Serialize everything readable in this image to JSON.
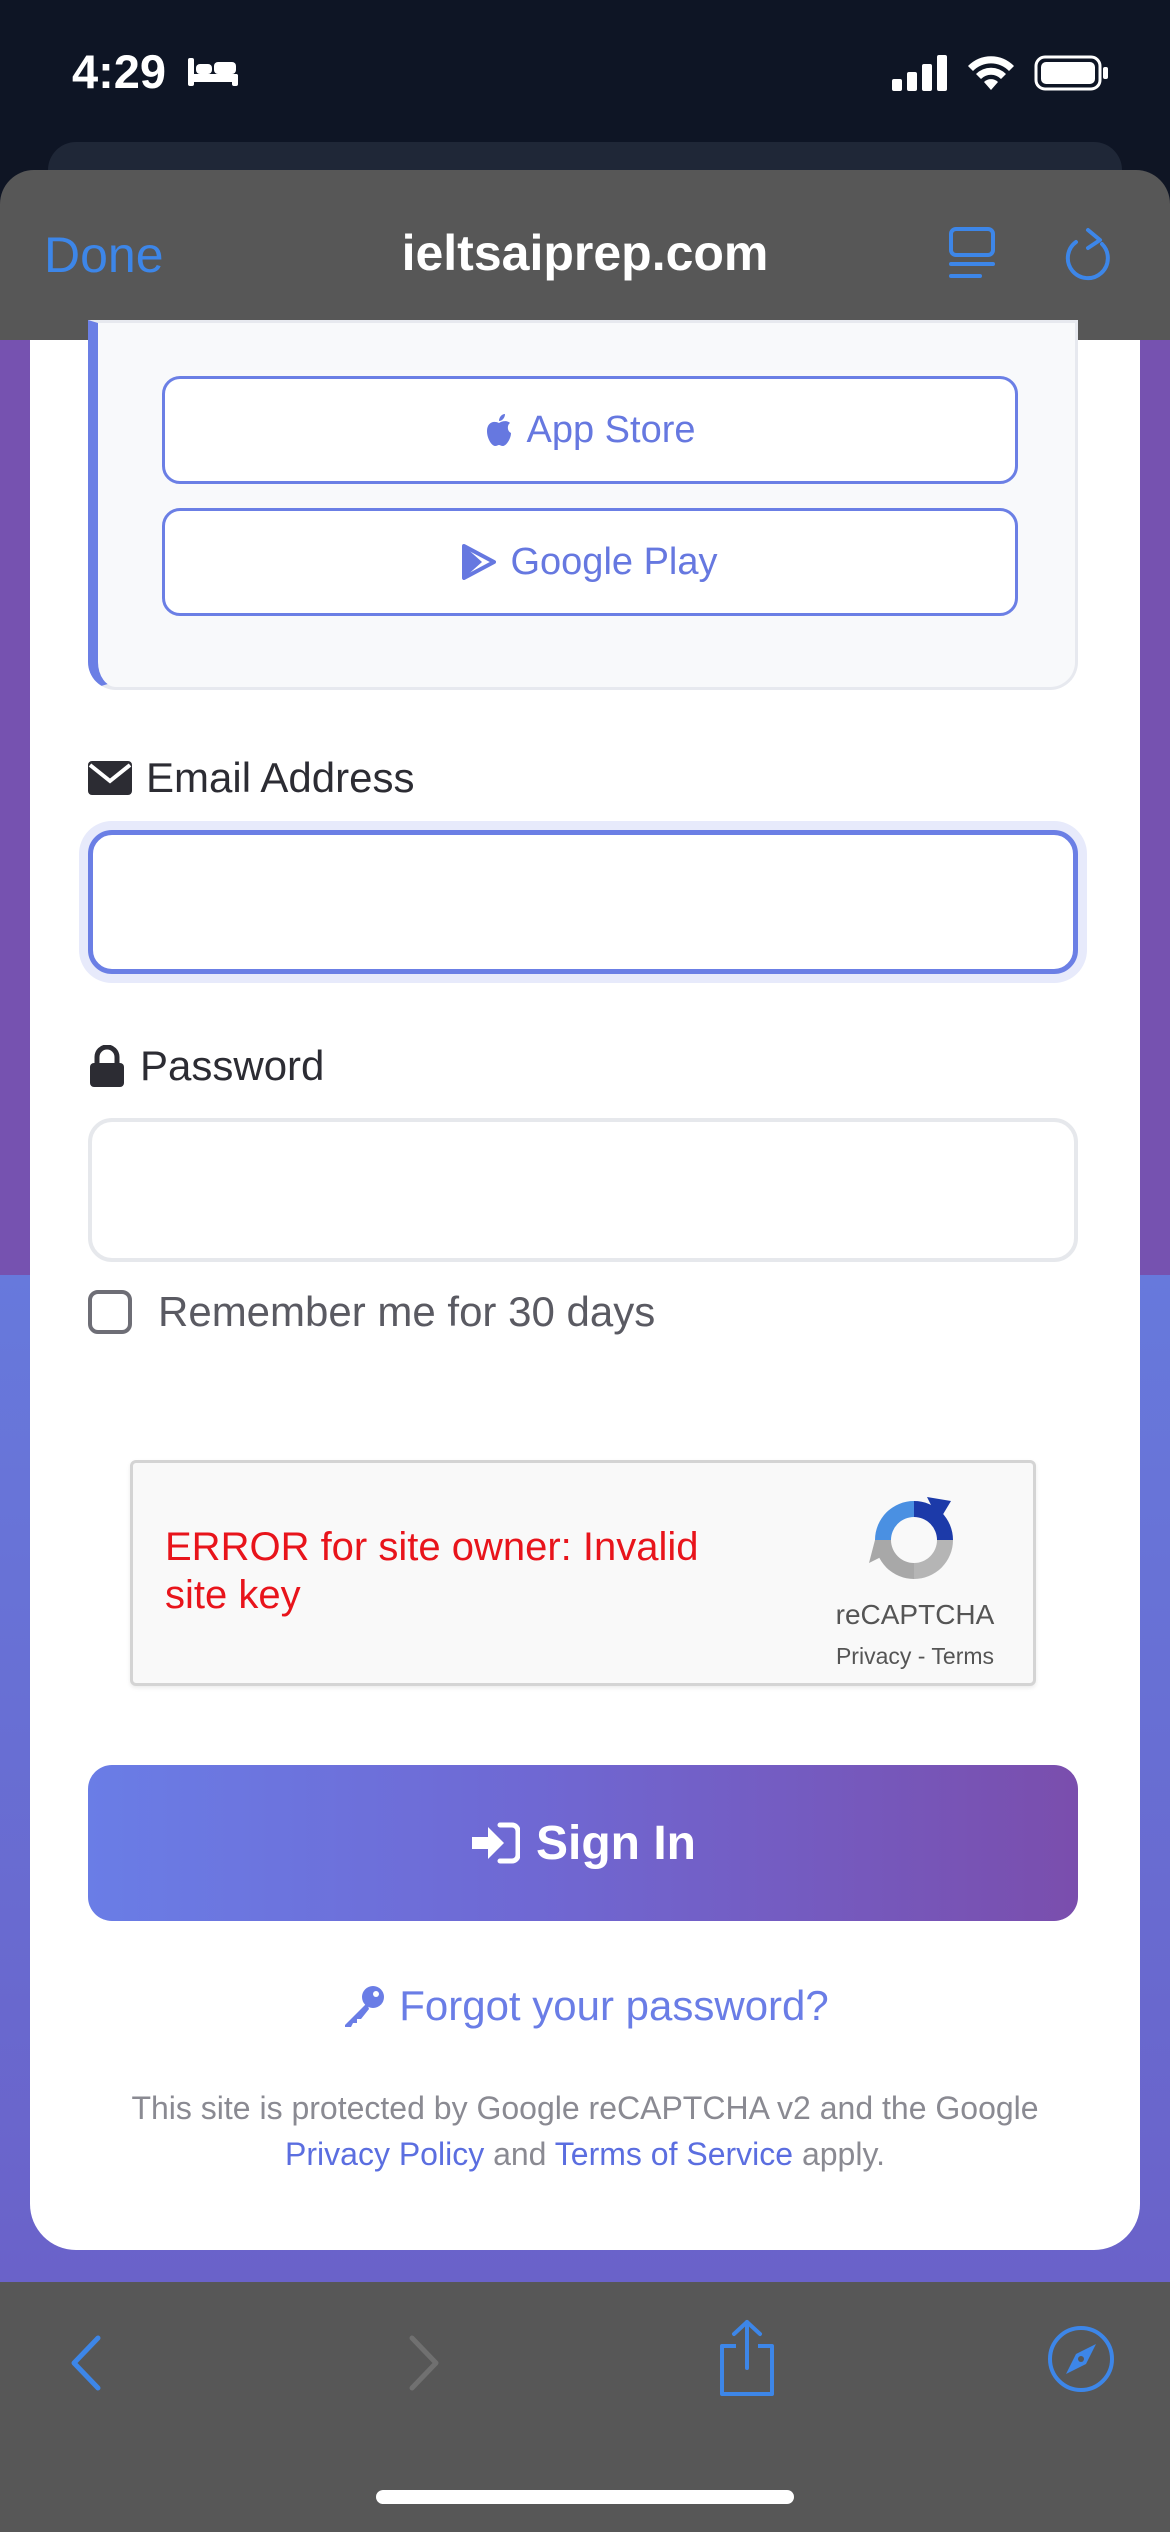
{
  "status_bar": {
    "time": "4:29"
  },
  "browser": {
    "done_label": "Done",
    "url": "ieltsaiprep.com"
  },
  "app_links": {
    "app_store": "App Store",
    "google_play": "Google Play"
  },
  "form": {
    "email_label": "Email Address",
    "email_value": "",
    "password_label": "Password",
    "password_value": "",
    "remember_label": "Remember me for 30 days",
    "remember_checked": false,
    "signin_label": "Sign In",
    "forgot_label": "Forgot your password?"
  },
  "recaptcha": {
    "error_text": "ERROR for site owner: Invalid site key",
    "brand": "reCAPTCHA",
    "privacy": "Privacy",
    "separator": " - ",
    "terms": "Terms"
  },
  "legal": {
    "prefix": "This site is protected by Google reCAPTCHA v2 and the Google ",
    "privacy_link": "Privacy Policy",
    "and": " and ",
    "terms_link": "Terms of Service",
    "suffix": " apply."
  },
  "colors": {
    "accent": "#6b7fe5",
    "ios_blue": "#3d86e8",
    "error": "#e8141b"
  }
}
